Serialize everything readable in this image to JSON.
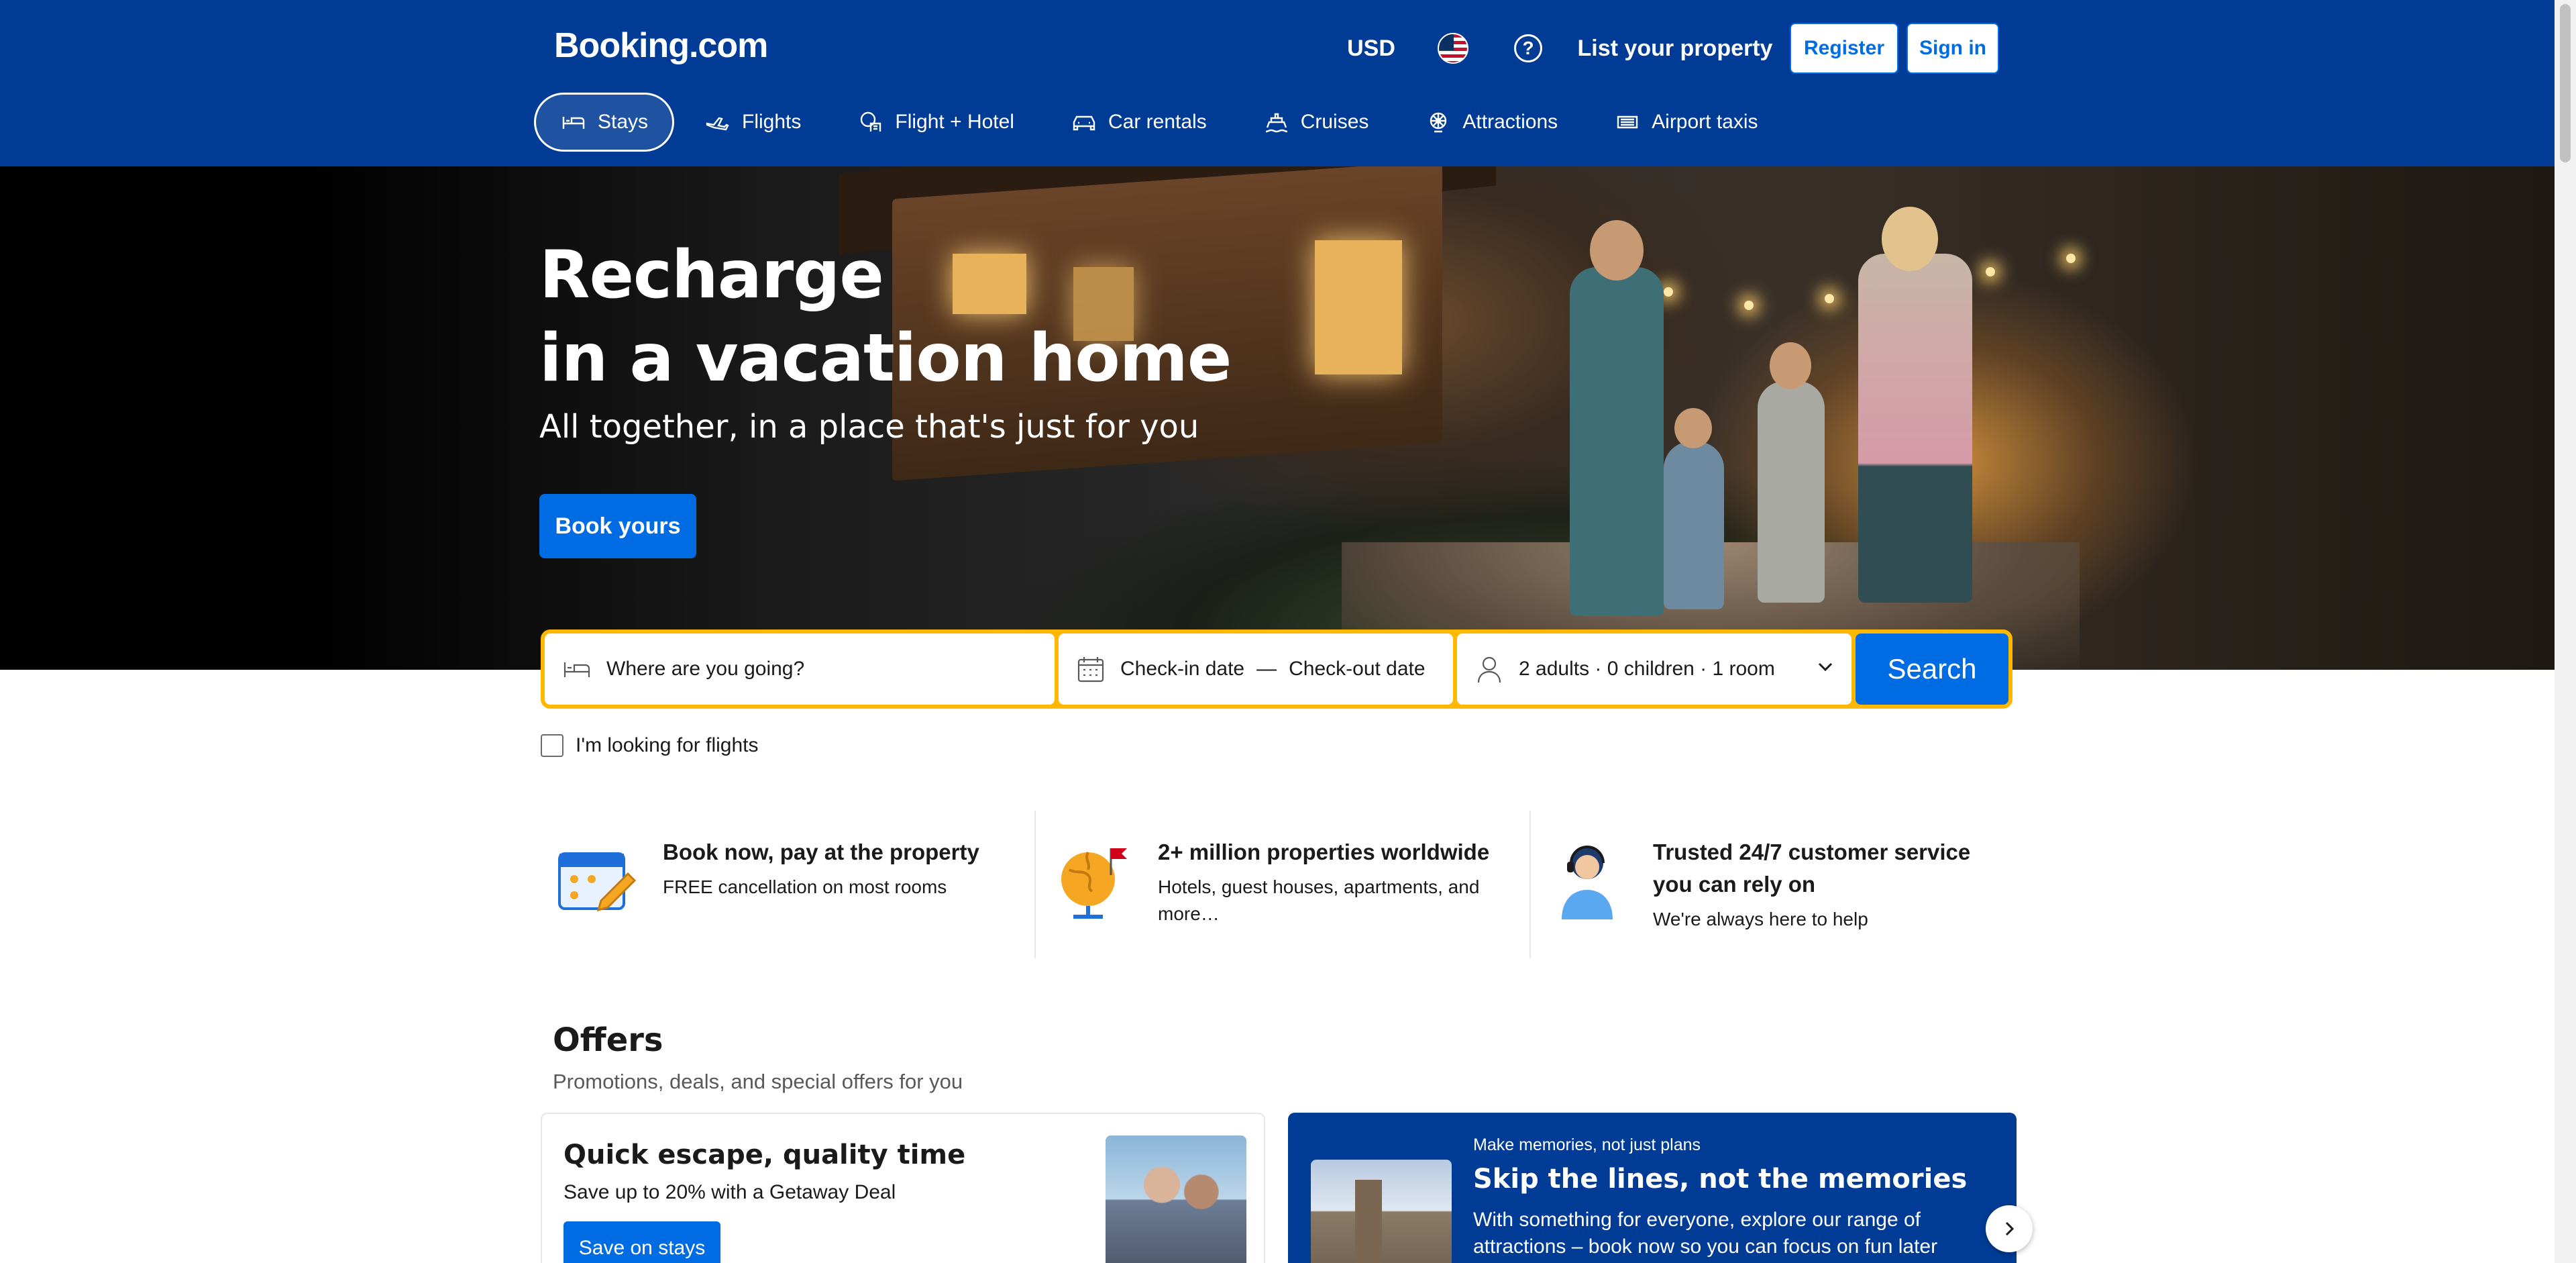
{
  "header": {
    "logo": "Booking.com",
    "currency": "USD",
    "flag_icon": "us-flag-icon",
    "help_icon": "help-circle-icon",
    "list_property": "List your property",
    "register": "Register",
    "sign_in": "Sign in",
    "background_color": "#003b95"
  },
  "nav": {
    "items": [
      {
        "label": "Stays",
        "icon": "bed-icon",
        "active": true
      },
      {
        "label": "Flights",
        "icon": "plane-icon"
      },
      {
        "label": "Flight + Hotel",
        "icon": "flight-hotel-icon"
      },
      {
        "label": "Car rentals",
        "icon": "car-icon"
      },
      {
        "label": "Cruises",
        "icon": "ship-icon"
      },
      {
        "label": "Attractions",
        "icon": "attractions-icon"
      },
      {
        "label": "Airport taxis",
        "icon": "taxi-icon"
      }
    ]
  },
  "hero": {
    "title_line1": "Recharge",
    "title_line2": "in a vacation home",
    "subtitle": "All together, in a place that's just for you",
    "cta": "Book yours"
  },
  "search": {
    "destination_placeholder": "Where are you going?",
    "checkin": "Check-in date",
    "date_separator": "—",
    "checkout": "Check-out date",
    "guests": "2 adults · 0 children · 1 room",
    "search_button": "Search",
    "flights_checkbox_label": "I'm looking for flights",
    "accent_color": "#ffb700",
    "button_color": "#006ce4"
  },
  "features": [
    {
      "title": "Book now, pay at the property",
      "text": "FREE cancellation on most rooms",
      "icon": "calendar-pencil-icon"
    },
    {
      "title": "2+ million properties worldwide",
      "text": "Hotels, guest houses, apartments, and more…",
      "icon": "globe-flag-icon"
    },
    {
      "title": "Trusted 24/7 customer service you can rely on",
      "text": "We're always here to help",
      "icon": "support-agent-icon"
    }
  ],
  "offers": {
    "title": "Offers",
    "subtitle": "Promotions, deals, and special offers for you",
    "card_left": {
      "title": "Quick escape, quality time",
      "text": "Save up to 20% with a Getaway Deal",
      "button": "Save on stays"
    },
    "card_right": {
      "kicker": "Make memories, not just plans",
      "title": "Skip the lines, not the memories",
      "text": "With something for everyone, explore our range of attractions – book now so you can focus on fun later"
    }
  }
}
